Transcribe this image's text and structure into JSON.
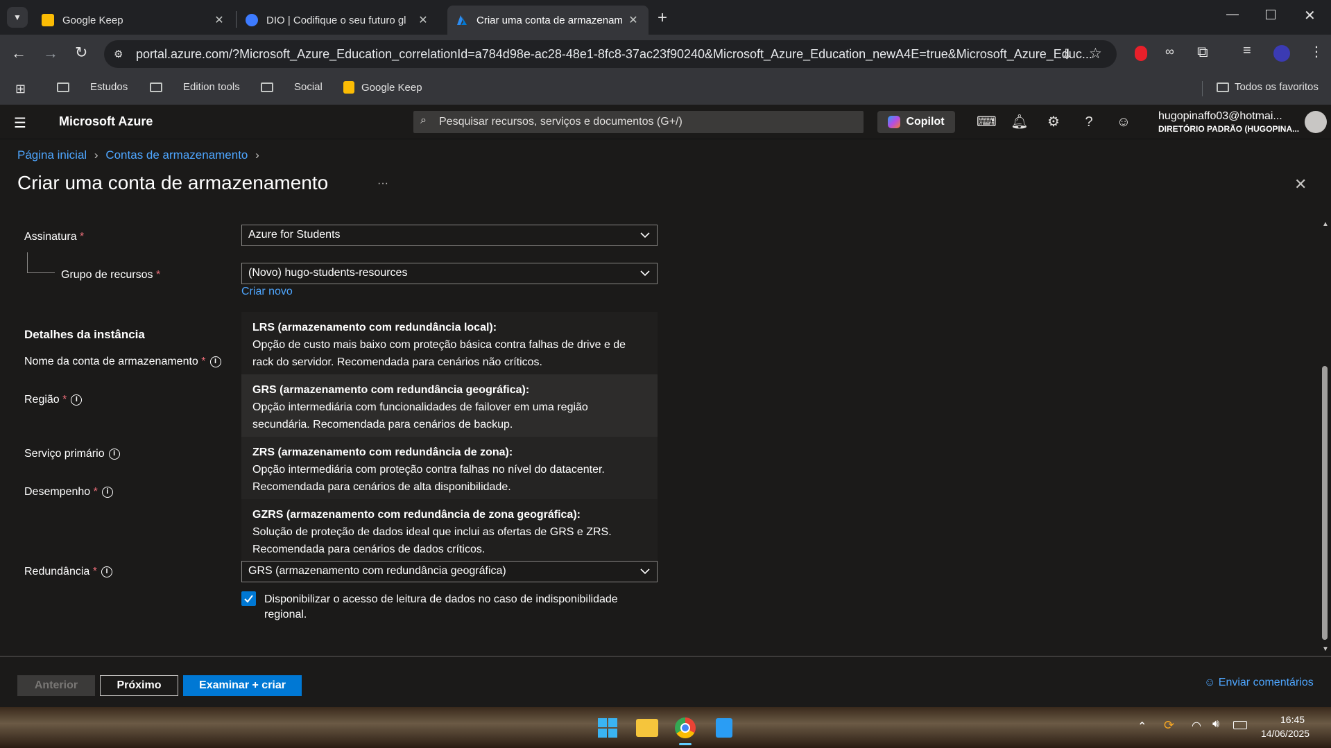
{
  "browser": {
    "tabs": [
      {
        "title": "Google Keep",
        "favicon_color": "#fbbc04",
        "active": false
      },
      {
        "title": "DIO | Codifique o seu futuro gl",
        "favicon_color": "#3d7bff",
        "active": false
      },
      {
        "title": "Criar uma conta de armazenam",
        "favicon_color": "#0078d4",
        "active": true
      }
    ],
    "url": "portal.azure.com/?Microsoft_Azure_Education_correlationId=a784d98e-ac28-48e1-8fc8-37ac23f90240&Microsoft_Azure_Education_newA4E=true&Microsoft_Azure_Educ...",
    "bookmarks": [
      "Estudos",
      "Edition tools",
      "Social",
      "Google Keep"
    ],
    "all_bookmarks": "Todos os favoritos"
  },
  "azure": {
    "brand": "Microsoft Azure",
    "search_placeholder": "Pesquisar recursos, serviços e documentos (G+/)",
    "copilot": "Copilot",
    "user_email": "hugopinaffo03@hotmai...",
    "user_directory": "DIRETÓRIO PADRÃO (HUGOPINA..."
  },
  "breadcrumb": [
    "Página inicial",
    "Contas de armazenamento"
  ],
  "page_title": "Criar uma conta de armazenamento",
  "more": "···",
  "form": {
    "subscription_label": "Assinatura",
    "subscription_value": "Azure for Students",
    "resource_group_label": "Grupo de recursos",
    "resource_group_value": "(Novo) hugo-students-resources",
    "create_new": "Criar novo",
    "instance_details": "Detalhes da instância",
    "account_name_label": "Nome da conta de armazenamento",
    "region_label": "Região",
    "primary_service_label": "Serviço primário",
    "performance_label": "Desempenho",
    "redundancy_label": "Redundância",
    "redundancy_value": "GRS (armazenamento com redundância geográfica)",
    "read_access_text_1": "Disponibilizar o acesso de leitura de dados no caso de indisponibilidade",
    "read_access_text_2": "regional.",
    "required_mark": "*"
  },
  "redundancy_options": [
    {
      "title": "LRS (armazenamento com redundância local):",
      "line1": "Opção de custo mais baixo com proteção básica contra falhas de drive e de",
      "line2": "rack do servidor. Recomendada para cenários não críticos."
    },
    {
      "title": "GRS (armazenamento com redundância geográfica):",
      "line1": "Opção intermediária com funcionalidades de failover em uma região",
      "line2": "secundária. Recomendada para cenários de backup."
    },
    {
      "title": "ZRS (armazenamento com redundância de zona):",
      "line1": "Opção intermediária com proteção contra falhas no nível do datacenter.",
      "line2": "Recomendada para cenários de alta disponibilidade."
    },
    {
      "title": "GZRS (armazenamento com redundância de zona geográfica):",
      "line1": "Solução de proteção de dados ideal que inclui as ofertas de GRS e ZRS.",
      "line2": "Recomendada para cenários de dados críticos."
    }
  ],
  "footer": {
    "previous": "Anterior",
    "next": "Próximo",
    "review_create": "Examinar + criar",
    "feedback": "Enviar comentários"
  },
  "taskbar": {
    "time": "16:45",
    "date": "14/06/2025"
  }
}
